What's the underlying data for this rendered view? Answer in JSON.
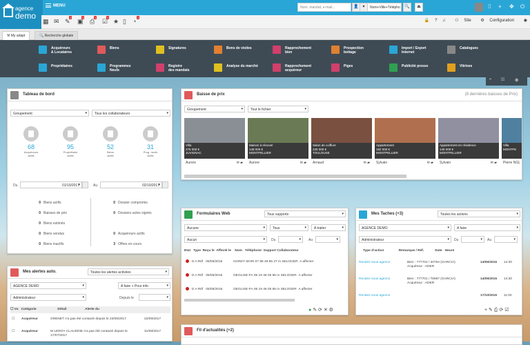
{
  "topbar": {
    "logo_line1": "agence",
    "logo_line2": "demo",
    "menu_label": "MENU",
    "search_placeholder": "Nom, mandat, e-mail...",
    "search2_value": "Nom+Ville+Télépho",
    "site_label": "Site",
    "config_label": "Configuration"
  },
  "badges": [
    "1",
    "1",
    "1",
    "1",
    "1"
  ],
  "tabs": [
    "My adapt",
    "Recherche globale"
  ],
  "shortcuts": [
    {
      "label": "Acquéreurs\n& Locataires",
      "color": "#2aa6d6"
    },
    {
      "label": "Biens",
      "color": "#e05a5a"
    },
    {
      "label": "Signatures",
      "color": "#e0c020"
    },
    {
      "label": "Bons de visites",
      "color": "#e08030"
    },
    {
      "label": "Rapprochement\nbien",
      "color": "#d0406a"
    },
    {
      "label": "Prospection\nboitage",
      "color": "#e08030"
    },
    {
      "label": "Import / Export\nInternet",
      "color": "#2aa6d6"
    },
    {
      "label": "Catalogues",
      "color": "#888888"
    },
    {
      "label": "Propriétaires",
      "color": "#2aa6d6"
    },
    {
      "label": "Programmes\nNeufs",
      "color": "#2aa6d6"
    },
    {
      "label": "Registre\ndes mandats",
      "color": "#d0406a"
    },
    {
      "label": "Analyse du marché",
      "color": "#e0c020"
    },
    {
      "label": "Rapprochement\nacquéreur",
      "color": "#d0406a"
    },
    {
      "label": "Piges",
      "color": "#d0406a"
    },
    {
      "label": "Publicité presse",
      "color": "#30a050"
    },
    {
      "label": "Vitrines",
      "color": "#e0a020"
    }
  ],
  "dashboard": {
    "title": "Tableau de bord",
    "groupement": "Groupement",
    "collab": "Tous les collaborateurs",
    "stats": [
      {
        "n": "68",
        "l1": "Acquéreurs",
        "l2": "actifs"
      },
      {
        "n": "95",
        "l1": "Propriétaire",
        "l2": "actifs"
      },
      {
        "n": "52",
        "l1": "Biens",
        "l2": "actifs"
      },
      {
        "n": "31",
        "l1": "Prog. neufs",
        "l2": "actifs"
      }
    ],
    "du_label": "Du",
    "du_value": "01/10/2017",
    "au_label": "Au",
    "au_value": "02/10/2017",
    "left": [
      {
        "n": "0",
        "l": "Biens actifs"
      },
      {
        "n": "0",
        "l": "Baisses de prix"
      },
      {
        "n": "0",
        "l": "Biens estimés"
      },
      {
        "n": "0",
        "l": "Biens vendus"
      },
      {
        "n": "0",
        "l": "Biens inactifs"
      }
    ],
    "right": [
      {
        "n": "0",
        "l": "Dossier compromis"
      },
      {
        "n": "0",
        "l": "Dossiers actes signés"
      },
      {
        "n": "0",
        "l": "Acquéreurs actifs"
      },
      {
        "n": "3",
        "l": "Offres en cours"
      }
    ]
  },
  "baisse": {
    "title": "Baisse de prix",
    "count": "(8 dernières baisses de Prix)",
    "groupement": "Groupement",
    "fichier": "Tout le fichier",
    "props": [
      {
        "type": "Villa",
        "price": "275 000 €",
        "city": "JUVIGNAC",
        "agent": "Aurore",
        "img": "#8a8f96"
      },
      {
        "type": "Maison à rénover",
        "price": "148 000 €",
        "city": "MONTPELLIER",
        "agent": "Aurore",
        "img": "#6a7a55"
      },
      {
        "type": "Salon de coiffure",
        "price": "230 000 €",
        "city": "TOULOUSE",
        "agent": "Arnaud",
        "img": "#7a5040"
      },
      {
        "type": "Appartement",
        "price": "182 000 €",
        "city": "MONTPELLIER",
        "agent": "Sylvain",
        "img": "#b07050"
      },
      {
        "type": "Appartement en résidence",
        "price": "145 000 €",
        "city": "MONTPELLIER",
        "agent": "Sylvain",
        "img": "#9090a0"
      },
      {
        "type": "Villa",
        "price": "",
        "city": "MONTPE",
        "agent": "Pierre NGL",
        "img": "#5080a0"
      }
    ]
  },
  "formulaires": {
    "title": "Formulaires Web",
    "supports": "Tous supports",
    "f1": "Aucune",
    "f2": "Tous",
    "f3": "A traiter",
    "f4": "Aucun",
    "du": "Du",
    "au": "Au",
    "cols": [
      "Etat",
      "Type",
      "Reçu le",
      "Affecté le",
      "Nom",
      "Téléphone",
      "Support",
      "Collaborateur"
    ],
    "rows": [
      {
        "type": "D A Réf",
        "date": "05/05/2016",
        "nom": "NARDY MARI",
        "tel": "07 86 48 85 27",
        "sup": "m SELOGER",
        "col": "A affecter"
      },
      {
        "type": "D A Réf",
        "date": "05/05/2016",
        "nom": "DEGLISE-FA",
        "tel": "06 19 46 05 65",
        "sup": "m SELOGER",
        "col": "A affecter"
      },
      {
        "type": "D A Réf",
        "date": "05/05/2016",
        "nom": "DEGLISE-FA",
        "tel": "06 19 46 05 65",
        "sup": "m SELOGER",
        "col": "A affecter"
      }
    ]
  },
  "taches": {
    "title": "Mes Taches (+3)",
    "actions": "Toutes les actions",
    "agence": "AGENCE DEMO",
    "afaire": "A faire",
    "admin": "Administrateur",
    "du": "Du",
    "au": "Au",
    "cols": [
      "Type d'action",
      "Remarque / Réf.",
      "Date",
      "Heure"
    ],
    "rows": [
      {
        "type": "Rendez-vous agence",
        "rem": "Bien : 777702 / 20754 (GARCIA)\nAcquéreur : ADER",
        "date": "14/06/2016",
        "heure": "14:30"
      },
      {
        "type": "Rendez-vous agence",
        "rem": "Bien : 777701 / 78697 (GARCIA)\nAcquéreur : ADER",
        "date": "14/06/2016",
        "heure": "14:30"
      },
      {
        "type": "Rendez-vous agence",
        "rem": "",
        "date": "17/10/2016",
        "heure": "11:00"
      }
    ]
  },
  "alertes": {
    "title": "Mes alertes auto.",
    "activees": "Toutes les alertes activées",
    "agence": "AGENCE DEMO",
    "afaire": "A faire + Pour info",
    "admin": "Administrateur",
    "depuis": "Depuis le",
    "cols": [
      "Vu",
      "Catégorie",
      "Détail",
      "Alerte du"
    ],
    "rows": [
      {
        "cat": "Acquéreur",
        "det": "GRENET n'a pas été contacté depuis le 23/08/2017",
        "date": "22/09/2017"
      },
      {
        "cat": "Acquéreur",
        "det": "M LEROY CLAUDINE n'a pas été contacté depuis le 17/07/2017",
        "date": "31/08/2017"
      }
    ]
  },
  "actu": {
    "title": "Fil d'actualités (+2)"
  }
}
